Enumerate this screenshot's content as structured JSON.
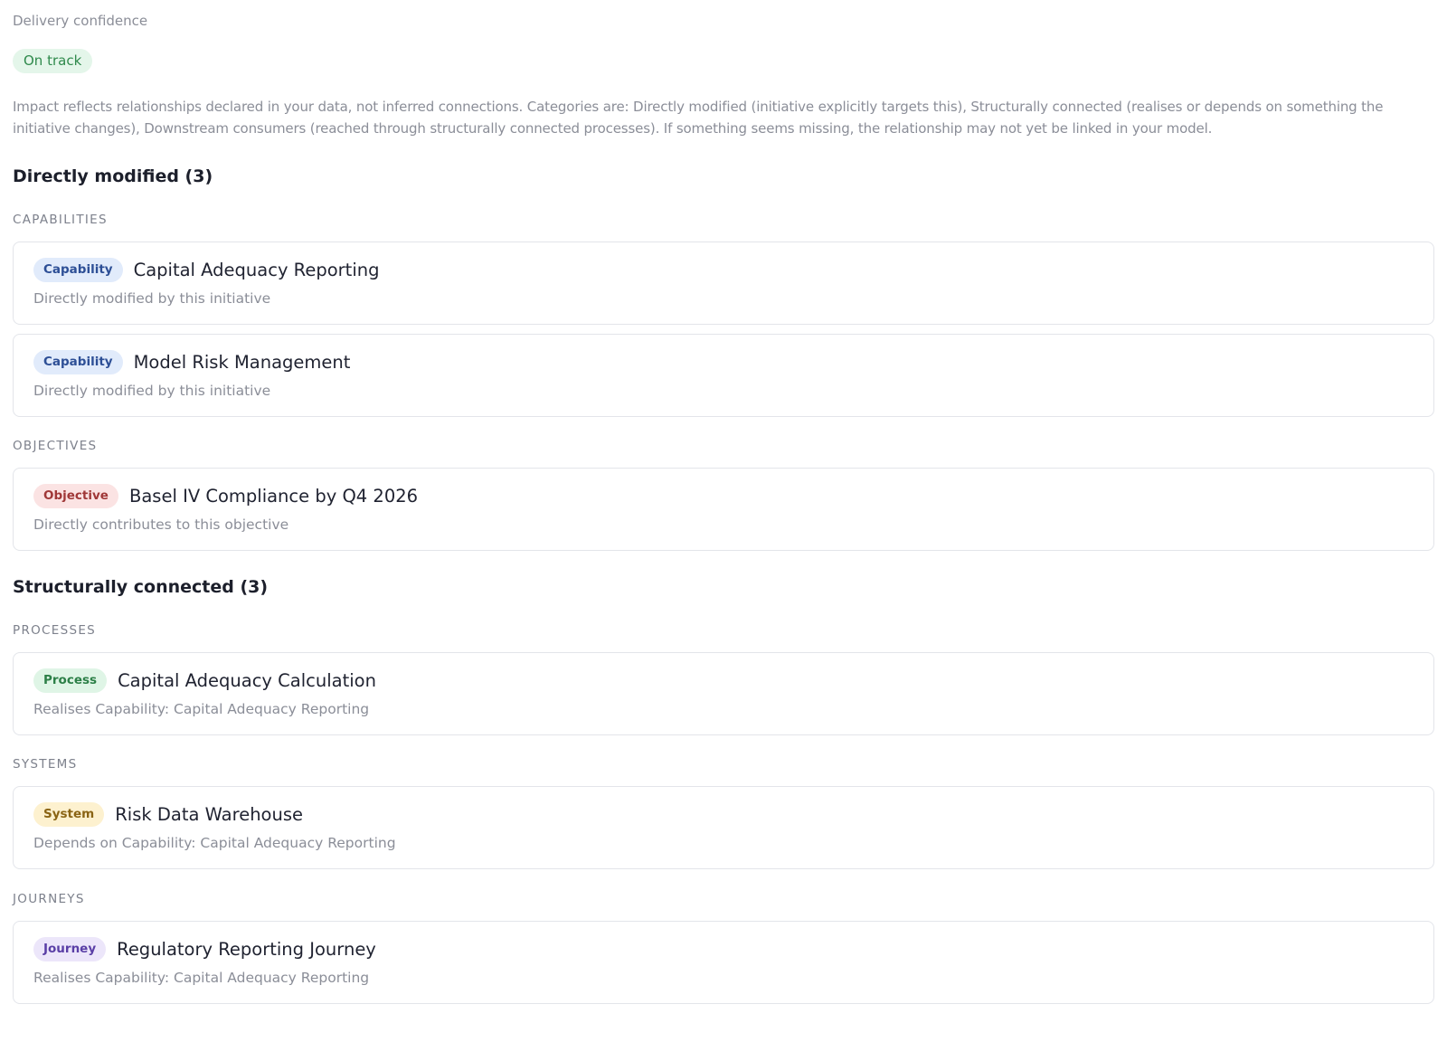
{
  "header": {
    "confidence_label": "Delivery confidence",
    "status": "On track",
    "status_color": "#2f8a4c"
  },
  "intro": "Impact reflects relationships declared in your data, not inferred connections. Categories are: Directly modified (initiative explicitly targets this), Structurally connected (realises or depends on something the initiative changes), Downstream consumers (reached through structurally connected processes). If something seems missing, the relationship may not yet be linked in your model.",
  "sections": [
    {
      "heading": "Directly modified (3)",
      "groups": [
        {
          "label": "CAPABILITIES",
          "items": [
            {
              "badge": "Capability",
              "title": "Capital Adequacy Reporting",
              "subtitle": "Directly modified by this initiative"
            },
            {
              "badge": "Capability",
              "title": "Model Risk Management",
              "subtitle": "Directly modified by this initiative"
            }
          ]
        },
        {
          "label": "OBJECTIVES",
          "items": [
            {
              "badge": "Objective",
              "title": "Basel IV Compliance by Q4 2026",
              "subtitle": "Directly contributes to this objective"
            }
          ]
        }
      ]
    },
    {
      "heading": "Structurally connected (3)",
      "groups": [
        {
          "label": "PROCESSES",
          "items": [
            {
              "badge": "Process",
              "title": "Capital Adequacy Calculation",
              "subtitle": "Realises Capability: Capital Adequacy Reporting"
            }
          ]
        },
        {
          "label": "SYSTEMS",
          "items": [
            {
              "badge": "System",
              "title": "Risk Data Warehouse",
              "subtitle": "Depends on Capability: Capital Adequacy Reporting"
            }
          ]
        },
        {
          "label": "JOURNEYS",
          "items": [
            {
              "badge": "Journey",
              "title": "Regulatory Reporting Journey",
              "subtitle": "Realises Capability: Capital Adequacy Reporting"
            }
          ]
        }
      ]
    }
  ]
}
